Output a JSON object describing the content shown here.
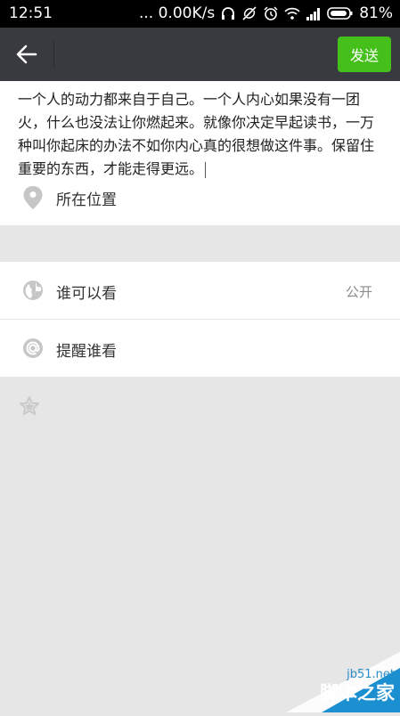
{
  "status_bar": {
    "time": "12:51",
    "network_speed": "... 0.00K/s",
    "battery": "81%",
    "icons": [
      "headset-icon",
      "sync-off-icon",
      "alarm-icon",
      "wifi-icon",
      "signal-icon",
      "battery-icon"
    ]
  },
  "header": {
    "back_icon": "back-arrow-icon",
    "send_label": "发送",
    "accent_color": "#45c01a"
  },
  "composer": {
    "text": "一个人的动力都来自于自己。一个人内心如果没有一团火，什么也没法让你燃起来。就像你决定早起读书，一万种叫你起床的办法不如你内心真的很想做这件事。保留住重要的东西，才能走得更远。",
    "location_label": "所在位置",
    "location_icon": "location-pin-icon"
  },
  "options": {
    "visibility_label": "谁可以看",
    "visibility_value": "公开",
    "visibility_icon": "globe-icon",
    "mention_label": "提醒谁看",
    "mention_icon": "at-sign-icon"
  },
  "extra": {
    "star_icon": "star-icon"
  },
  "watermark": {
    "site": "jb51.net",
    "name": "脚本之家"
  }
}
